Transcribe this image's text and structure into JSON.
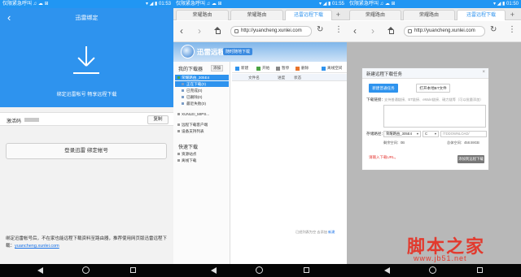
{
  "statusbars": [
    {
      "left": "仅限紧急呼叫 ♫ ☁ ⊞",
      "right": "▾ ◢ ▮ 01:53"
    },
    {
      "left": "仅限紧急呼叫 ♫ ☁ ⊞",
      "right": "▾ ◢ ▮ 01:55"
    },
    {
      "left": "仅限紧急呼叫 ♫ ☁ ⊞",
      "right": "▾ ◢ ▮ 01:50"
    }
  ],
  "bind_page": {
    "title": "迅雷绑定",
    "description": "绑定迅雷帐号 畅享远程下载",
    "activation_label": "激活码",
    "copy_button": "复制",
    "bind_button": "登录迅雷 绑定帐号",
    "footer_text": "绑定迅雷帐号后，不在家也能远程下载资料至路由器，推荐使用网页版迅雷远程下载：",
    "footer_link": "yuancheng.xunlei.com"
  },
  "browser": {
    "tabs": [
      "荣耀路由",
      "荣耀路由",
      "迅雷远程下载"
    ],
    "url": "http://yuancheng.xunlei.com"
  },
  "xunlei_web": {
    "logo": "迅雷远程下载",
    "tagline": "随时随地下载",
    "sidebar_title": "我的下载器",
    "add_button": "添加",
    "device_row": "荣耀路由_305E4",
    "items": [
      "正在下载(0)",
      "已完成(0)",
      "已删除(0)",
      "最近失败(0)"
    ],
    "second_device": "XUNLEI_MIPS...",
    "sub_items": [
      "远程下载客户端",
      "设备支持列表"
    ],
    "quick_section": "快速下载",
    "quick_items": [
      "资源站点",
      "离线下载"
    ],
    "toolbar": [
      "新建",
      "开始",
      "暂停",
      "删除",
      "离线空间"
    ],
    "columns": [
      "文件名",
      "进度",
      "状态"
    ],
    "footer": "已经列表为空 去添加 ",
    "footer_link": "新建"
  },
  "new_task_modal": {
    "title": "新建远程下载任务",
    "close": "×",
    "tab_active": "新建普通任务",
    "tab_other": "打开本地BT文件",
    "link_label": "下载链接：",
    "link_hint": "支持普通链接、BT链接、eMule链接、磁力链等（可以批量添加）",
    "save_label": "存储路径：",
    "device_select": "荣耀路由_305E4",
    "partition_select": "C",
    "path_placeholder": "/TDDOWNLOAD/",
    "free_space_label": "剩余空间：0B",
    "total_space_label": "总体空间：458.59GB",
    "warning": "请输入下载URL。",
    "submit": "添加到远程下载"
  },
  "watermark": {
    "cn": "脚本之家",
    "url": "www.jb51.net"
  },
  "colors": {
    "brand_blue": "#2e93ee",
    "warning_red": "#e53935",
    "watermark_red": "#e23a2e"
  }
}
